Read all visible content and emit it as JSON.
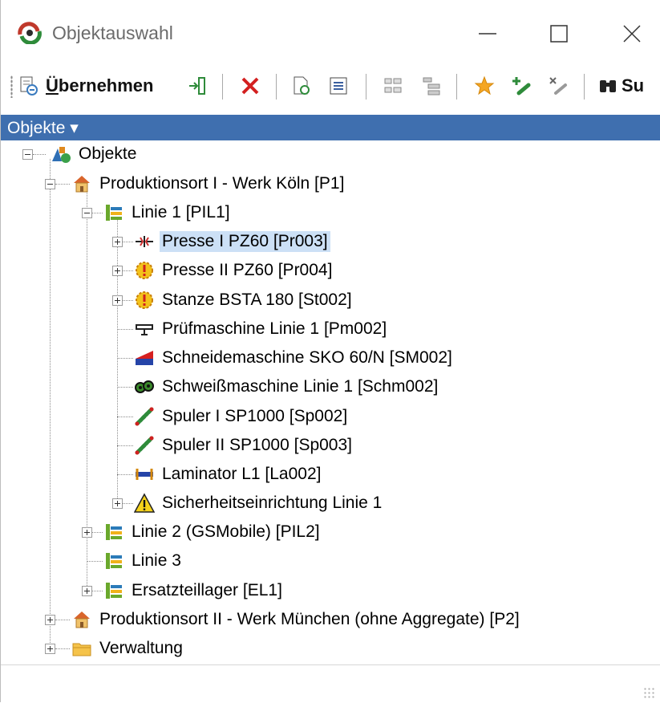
{
  "window": {
    "title": "Objektauswahl",
    "controls": {
      "minimize_icon": "minimize-icon",
      "maximize_icon": "maximize-icon",
      "close_icon": "close-icon"
    }
  },
  "toolbar": {
    "apply_prefix": "Ü",
    "apply_rest": "bernehmen",
    "search_partial": "Su"
  },
  "header": {
    "label": "Objekte ▾"
  },
  "tree": {
    "root": "Objekte",
    "p1": "Produktionsort I - Werk Köln [P1]",
    "linie1": "Linie 1 [PIL1]",
    "presse1": "Presse I PZ60 [Pr003]",
    "presse2": "Presse II PZ60 [Pr004]",
    "stanze": "Stanze BSTA 180 [St002]",
    "pruef": "Prüfmaschine Linie 1 [Pm002]",
    "schneide": "Schneidemaschine SKO 60/N [SM002]",
    "schweiss": "Schweißmaschine Linie 1 [Schm002]",
    "spuler1": "Spuler I SP1000 [Sp002]",
    "spuler2": "Spuler II SP1000 [Sp003]",
    "laminator": "Laminator L1 [La002]",
    "sicherheit": "Sicherheitseinrichtung Linie 1",
    "linie2": "Linie 2 (GSMobile) [PIL2]",
    "linie3": "Linie 3",
    "ersatz": "Ersatzteillager [EL1]",
    "p2": "Produktionsort II - Werk München (ohne Aggregate) [P2]",
    "verwaltung": "Verwaltung"
  },
  "colors": {
    "header_bg": "#3f6faf",
    "selection_bg": "#cce0f6"
  }
}
